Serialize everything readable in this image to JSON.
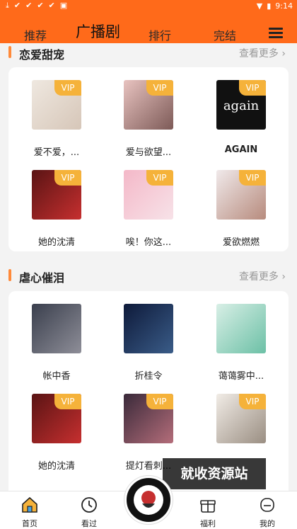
{
  "status_bar": {
    "time": "9:14",
    "icons": [
      "download-icon",
      "check-icon",
      "check-icon",
      "check-icon",
      "check-icon",
      "app-icon"
    ]
  },
  "top_nav": {
    "tabs": [
      "推荐",
      "广播剧",
      "排行",
      "完结"
    ],
    "active_tab": "广播剧"
  },
  "sections": [
    {
      "title": "恋爱甜宠",
      "more": "查看更多 ›",
      "items": [
        {
          "title": "爱不爱，...",
          "vip": "VIP",
          "cover_colors": [
            "#efe8e0",
            "#d6c6b8"
          ]
        },
        {
          "title": "爱与欲望...",
          "vip": "VIP",
          "cover_colors": [
            "#e8c3c0",
            "#7d5a57"
          ]
        },
        {
          "title": "AGAIN",
          "vip": "VIP",
          "cover_colors": [
            "#111111",
            "#111111"
          ],
          "cover_text": "again"
        },
        {
          "title": "她的沈清",
          "vip": "VIP",
          "cover_colors": [
            "#5a1414",
            "#c62f2f"
          ]
        },
        {
          "title": "唉！你这...",
          "vip": "VIP",
          "cover_colors": [
            "#f4b8c8",
            "#f7e2e8"
          ]
        },
        {
          "title": "爱欲燃燃",
          "vip": "VIP",
          "cover_colors": [
            "#f0e9ea",
            "#b78b7d"
          ]
        }
      ]
    },
    {
      "title": "虐心催泪",
      "more": "查看更多 ›",
      "items": [
        {
          "title": "帐中香",
          "vip": "",
          "cover_colors": [
            "#3a3f4d",
            "#8e8e98"
          ]
        },
        {
          "title": "折桂令",
          "vip": "",
          "cover_colors": [
            "#0e1a3a",
            "#3a5c88"
          ]
        },
        {
          "title": "蔼蔼雾中...",
          "vip": "",
          "cover_colors": [
            "#d8efe6",
            "#6cc0a6"
          ]
        },
        {
          "title": "她的沈清",
          "vip": "VIP",
          "cover_colors": [
            "#5a1414",
            "#c62f2f"
          ]
        },
        {
          "title": "提灯看刺...",
          "vip": "VIP",
          "cover_colors": [
            "#3a2a3a",
            "#b46d7a"
          ]
        },
        {
          "title": "",
          "vip": "VIP",
          "cover_colors": [
            "#f1ece6",
            "#9a8e82"
          ]
        }
      ]
    }
  ],
  "bottom_nav": [
    {
      "label": "首页",
      "icon": "home-icon"
    },
    {
      "label": "看过",
      "icon": "clock-icon"
    },
    {
      "label": "福利",
      "icon": "gift-icon"
    },
    {
      "label": "我的",
      "icon": "profile-icon"
    }
  ],
  "watermark": "就收资源站",
  "colors": {
    "accent": "#ff6a1a",
    "vip": "#f5b23a",
    "section_bar": "#ff8a3a"
  }
}
